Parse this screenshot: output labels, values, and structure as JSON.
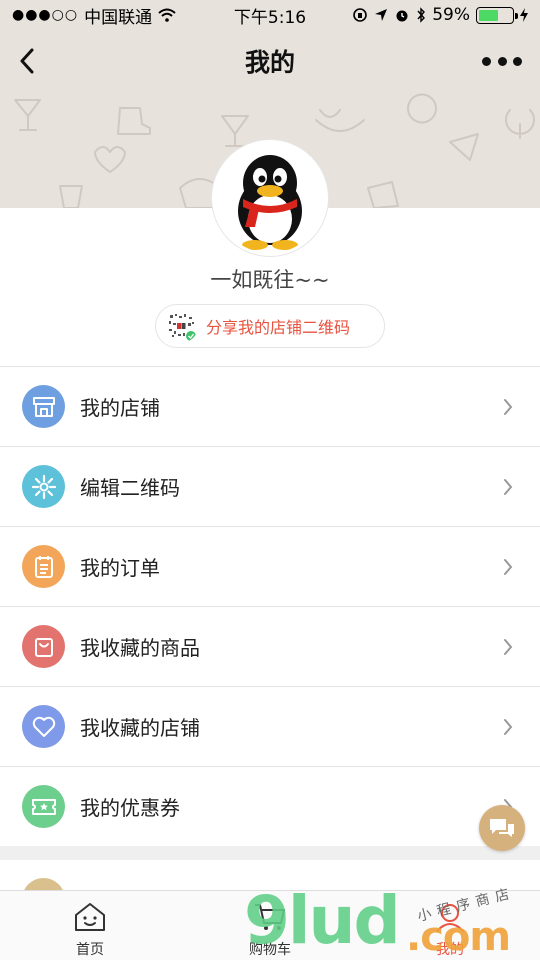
{
  "status_bar": {
    "carrier": "中国联通",
    "time": "下午5:16",
    "battery": "59%",
    "signal_dots": "●●●○○"
  },
  "nav": {
    "title": "我的"
  },
  "profile": {
    "nickname": "一如既往~~",
    "share_qr_label": "分享我的店铺二维码"
  },
  "menu": {
    "items": [
      {
        "label": "我的店铺",
        "icon": "shop-icon",
        "color": "#6e9fe0"
      },
      {
        "label": "编辑二维码",
        "icon": "qrcode-icon",
        "color": "#5dc1d9"
      },
      {
        "label": "我的订单",
        "icon": "order-icon",
        "color": "#f3a55a"
      },
      {
        "label": "我收藏的商品",
        "icon": "bag-icon",
        "color": "#e2736e"
      },
      {
        "label": "我收藏的店铺",
        "icon": "heart-icon",
        "color": "#7e9ae8"
      },
      {
        "label": "我的优惠券",
        "icon": "coupon-icon",
        "color": "#6dcf8e"
      }
    ]
  },
  "tabbar": {
    "tabs": [
      {
        "label": "首页",
        "icon": "home-icon"
      },
      {
        "label": "购物车",
        "icon": "cart-icon"
      },
      {
        "label": "我的",
        "icon": "user-icon",
        "active": true
      }
    ]
  },
  "watermark": {
    "main": "9lud",
    "com": ".com",
    "cn": "小程序商店"
  },
  "colors": {
    "accent": "#e8533f",
    "header_bg": "#e7e2dc",
    "chat_fab": "#d5b27d"
  }
}
